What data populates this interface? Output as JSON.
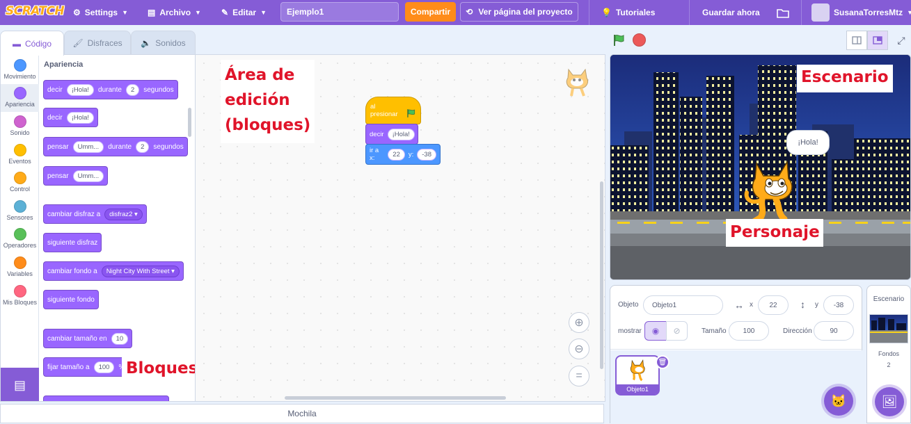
{
  "menubar": {
    "logo": "SCRATCH",
    "settings": "Settings",
    "file": "Archivo",
    "edit": "Editar",
    "project_title": "Ejemplo1",
    "share": "Compartir",
    "project_page": "Ver página del proyecto",
    "tutorials": "Tutoriales",
    "save_now": "Guardar ahora",
    "username": "SusanaTorresMtz"
  },
  "tabs": {
    "code": "Código",
    "costumes": "Disfraces",
    "sounds": "Sonidos"
  },
  "categories": [
    {
      "label": "Movimiento",
      "color": "#4c97ff"
    },
    {
      "label": "Apariencia",
      "color": "#9966ff"
    },
    {
      "label": "Sonido",
      "color": "#cf63cf"
    },
    {
      "label": "Eventos",
      "color": "#ffbf00"
    },
    {
      "label": "Control",
      "color": "#ffab19"
    },
    {
      "label": "Sensores",
      "color": "#5cb1d6"
    },
    {
      "label": "Operadores",
      "color": "#59c059"
    },
    {
      "label": "Variables",
      "color": "#ff8c1a"
    },
    {
      "label": "Mis Bloques",
      "color": "#ff6680"
    }
  ],
  "palette": {
    "title": "Apariencia",
    "b1": {
      "t1": "decir",
      "v1": "¡Hola!",
      "t2": "durante",
      "v2": "2",
      "t3": "segundos"
    },
    "b2": {
      "t1": "decir",
      "v1": "¡Hola!"
    },
    "b3": {
      "t1": "pensar",
      "v1": "Umm...",
      "t2": "durante",
      "v2": "2",
      "t3": "segundos"
    },
    "b4": {
      "t1": "pensar",
      "v1": "Umm..."
    },
    "b5": {
      "t1": "cambiar disfraz a",
      "v1": "disfraz2"
    },
    "b6": {
      "t1": "siguiente disfraz"
    },
    "b7": {
      "t1": "cambiar fondo a",
      "v1": "Night City With Street"
    },
    "b8": {
      "t1": "siguiente fondo"
    },
    "b9": {
      "t1": "cambiar tamaño en",
      "v1": "10"
    },
    "b10": {
      "t1": "fijar tamaño a",
      "v1": "100",
      "t2": "%"
    }
  },
  "annotations": {
    "edit_area_1": "Área de",
    "edit_area_2": "edición",
    "edit_area_3": "(bloques)",
    "code_blocks": "Bloques de código",
    "stage": "Escenario",
    "character": "Personaje"
  },
  "script": {
    "hat": "al presionar",
    "say": "decir",
    "say_value": "¡Hola!",
    "goto_prefix": "ir a x:",
    "x": "22",
    "y_label": "y:",
    "y": "-38"
  },
  "backpack": "Mochila",
  "stage": {
    "speech": "¡Hola!"
  },
  "sprite_info": {
    "object_label": "Objeto",
    "object_name": "Objeto1",
    "x_label": "x",
    "x": "22",
    "y_label": "y",
    "y": "-38",
    "show_label": "mostrar",
    "size_label": "Tamaño",
    "size": "100",
    "direction_label": "Dirección",
    "direction": "90",
    "sprite_thumb": "Objeto1"
  },
  "stage_panel": {
    "title": "Escenario",
    "backdrops_label": "Fondos",
    "backdrops_count": "2"
  }
}
